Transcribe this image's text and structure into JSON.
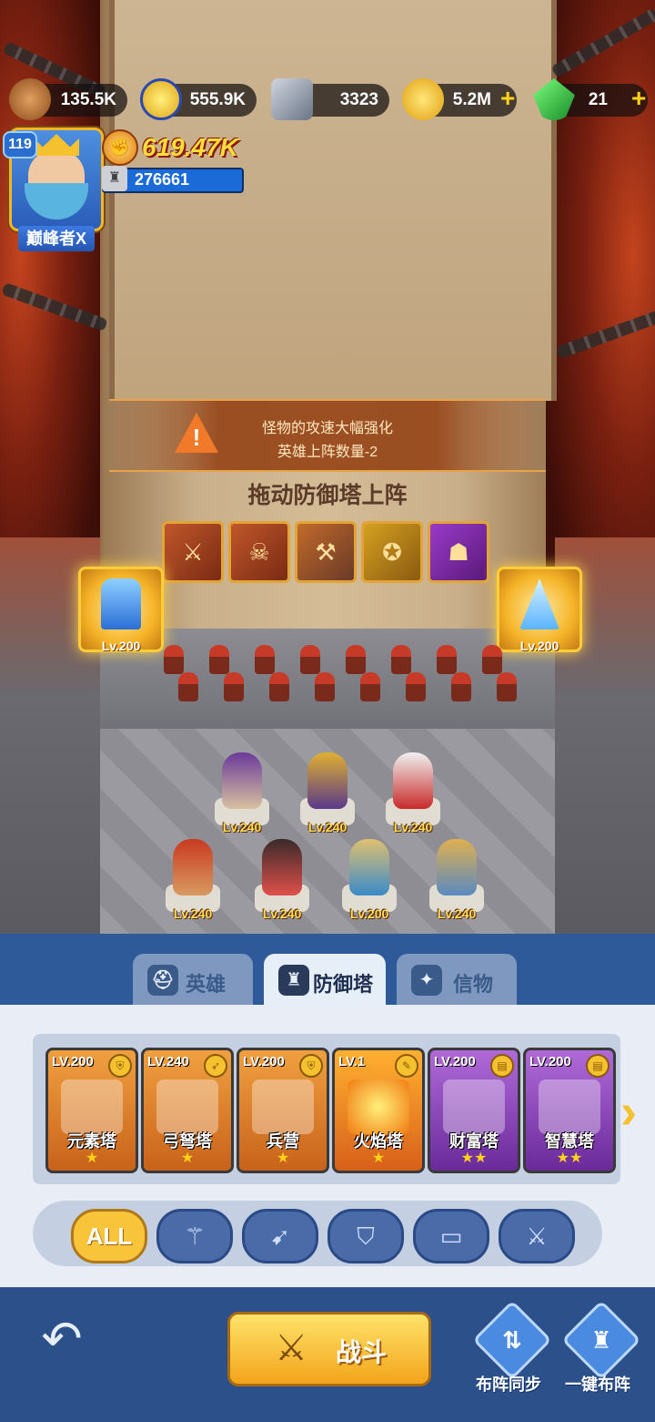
{
  "resources": {
    "wood": {
      "value": "135.5K",
      "icon": "wood-log-icon"
    },
    "medal": {
      "value": "555.9K",
      "icon": "star-medal-icon"
    },
    "ore": {
      "value": "3323",
      "icon": "iron-ore-icon"
    },
    "gold": {
      "value": "5.2M",
      "icon": "gold-coin-icon"
    },
    "gem": {
      "value": "21",
      "icon": "green-gem-icon"
    }
  },
  "player": {
    "level": "119",
    "rank_title": "巅峰者X",
    "power": "619.47K",
    "castle_power": "276661"
  },
  "battle": {
    "warning_line1": "怪物的攻速大幅强化",
    "warning_line2": "英雄上阵数量-2",
    "drag_hint": "拖动防御塔上阵",
    "left_tower_level": "Lv.200",
    "right_tower_level": "Lv.200",
    "heroes": [
      {
        "level": "Lv.240"
      },
      {
        "level": "Lv.240"
      },
      {
        "level": "Lv.240"
      },
      {
        "level": "Lv.240"
      },
      {
        "level": "Lv.240"
      },
      {
        "level": "Lv.200"
      },
      {
        "level": "Lv.240"
      }
    ]
  },
  "tabs": [
    {
      "label": "英雄",
      "icon": "helmet-icon"
    },
    {
      "label": "防御塔",
      "icon": "tower-icon"
    },
    {
      "label": "信物",
      "icon": "token-icon"
    }
  ],
  "towers": [
    {
      "level": "LV.200",
      "name": "元素塔",
      "stars": "★"
    },
    {
      "level": "LV.240",
      "name": "弓弩塔",
      "stars": "★"
    },
    {
      "level": "LV.200",
      "name": "兵营",
      "stars": "★"
    },
    {
      "level": "LV.1",
      "name": "火焰塔",
      "stars": "★"
    },
    {
      "level": "LV.200",
      "name": "财富塔",
      "stars": "★★"
    },
    {
      "level": "LV.200",
      "name": "智慧塔",
      "stars": "★★"
    }
  ],
  "filters": {
    "all": "ALL"
  },
  "actions": {
    "fight": "战斗",
    "sync": "布阵同步",
    "auto": "一键布阵"
  },
  "colors": {
    "accent_gold": "#f7c43a",
    "panel_blue": "#2e5a9a",
    "power_yellow": "#ffde3a"
  }
}
